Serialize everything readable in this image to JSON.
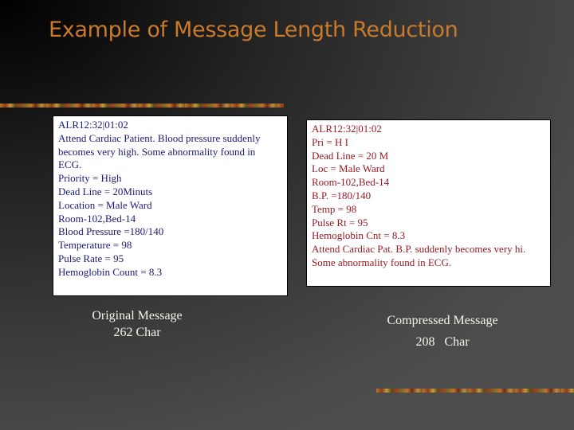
{
  "slide": {
    "title": "Example of Message Length Reduction",
    "original": {
      "lines": [
        "ALR12:32|01:02",
        "Attend Cardiac Patient. Blood pressure suddenly",
        "becomes very high. Some abnormality found in",
        "ECG.",
        "Priority = High",
        "Dead Line = 20Minuts",
        "Location = Male Ward",
        "Room-102,Bed-14",
        "Blood Pressure =180/140",
        "Temperature = 98",
        "Pulse Rate = 95",
        "Hemoglobin Count = 8.3"
      ],
      "caption": "Original Message",
      "count": "262 Char"
    },
    "compressed": {
      "lines": [
        "ALR12:32|01:02",
        "Pri = H I",
        "Dead Line = 20 M",
        "Loc = Male Ward",
        "Room-102,Bed-14",
        "B.P. =180/140",
        "Temp = 98",
        "Pulse Rt = 95",
        "Hemoglobin Cnt = 8.3",
        "Attend Cardiac Pat. B.P. suddenly becomes very hi.",
        "Some abnormality found in ECG."
      ],
      "caption": "Compressed Message",
      "count": "208   Char"
    },
    "colors": {
      "title": "#c97a2a",
      "original_text": "#1a1a7a",
      "compressed_text": "#9a1a24",
      "caption_text": "#f4f4ec"
    }
  }
}
